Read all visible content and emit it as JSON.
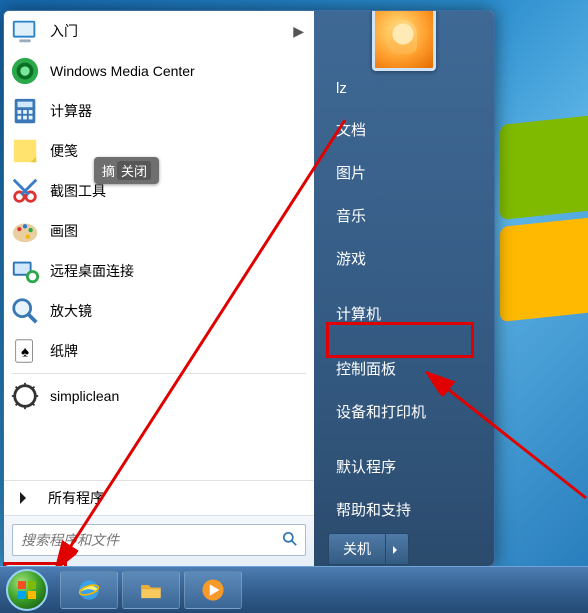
{
  "user": {
    "name": "lz"
  },
  "left_panel": {
    "items": [
      {
        "label": "入门",
        "icon": "getting-started",
        "has_submenu": true
      },
      {
        "label": "Windows Media Center",
        "icon": "media-center"
      },
      {
        "label": "计算器",
        "icon": "calculator"
      },
      {
        "label": "便笺",
        "icon": "sticky-notes"
      },
      {
        "label": "截图工具",
        "icon": "snipping-tool"
      },
      {
        "label": "画图",
        "icon": "paint"
      },
      {
        "label": "远程桌面连接",
        "icon": "remote-desktop"
      },
      {
        "label": "放大镜",
        "icon": "magnifier"
      },
      {
        "label": "纸牌",
        "icon": "solitaire"
      },
      {
        "label": "simpliclean",
        "icon": "simpliclean"
      }
    ],
    "all_programs_label": "所有程序",
    "search_placeholder": "搜索程序和文件"
  },
  "tooltip": {
    "part1": "摘",
    "part2": "关闭"
  },
  "right_panel": {
    "items": [
      "lz",
      "文档",
      "图片",
      "音乐",
      "游戏",
      "计算机",
      "控制面板",
      "设备和打印机",
      "默认程序",
      "帮助和支持"
    ],
    "shutdown_label": "关机",
    "highlight_index": 6,
    "separators_after": [
      4,
      5,
      7
    ]
  },
  "taskbar": {
    "buttons": [
      "ie",
      "explorer",
      "media-player"
    ]
  },
  "annotations": {
    "highlight_start_button": true,
    "highlight_right_index": 6,
    "arrows": [
      {
        "from": "right-panel-control-panel",
        "to": "start-orb"
      },
      {
        "from": "bottom-right",
        "to": "devices-printers"
      }
    ]
  },
  "icons": {
    "search": "search"
  }
}
